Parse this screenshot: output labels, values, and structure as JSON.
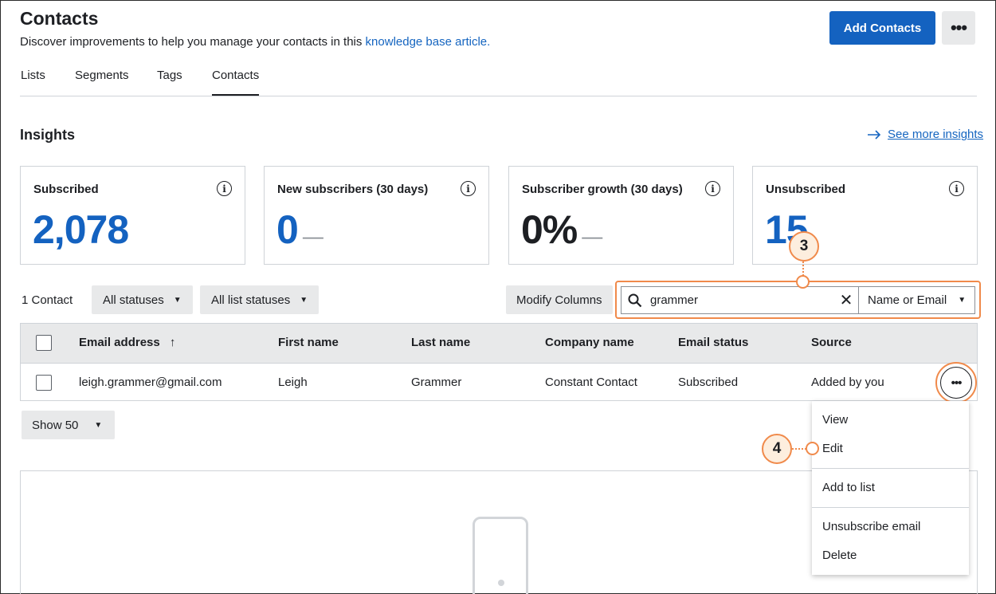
{
  "page": {
    "title": "Contacts",
    "subtitle": "Discover improvements to help you manage your contacts in this ",
    "subtitle_link": "knowledge base article."
  },
  "header": {
    "add_contacts": "Add Contacts",
    "more_icon": "more-horizontal-icon"
  },
  "tabs": [
    {
      "label": "Lists"
    },
    {
      "label": "Segments"
    },
    {
      "label": "Tags"
    },
    {
      "label": "Contacts",
      "active": true
    }
  ],
  "insights": {
    "title": "Insights",
    "see_more": "See more insights",
    "cards": [
      {
        "label": "Subscribed",
        "value": "2,078",
        "dash": ""
      },
      {
        "label": "New subscribers (30 days)",
        "value": "0",
        "dash": "—"
      },
      {
        "label": "Subscriber growth (30 days)",
        "value": "0%",
        "dash": "—"
      },
      {
        "label": "Unsubscribed",
        "value": "15",
        "dash": ""
      }
    ]
  },
  "filters": {
    "count": "1 Contact",
    "statuses": "All statuses",
    "list_statuses": "All list statuses",
    "modify_columns": "Modify Columns",
    "search_value": "grammer",
    "search_field": "Name or Email"
  },
  "table": {
    "headers": [
      "Email address",
      "First name",
      "Last name",
      "Company name",
      "Email status",
      "Source"
    ],
    "rows": [
      [
        "leigh.grammer@gmail.com",
        "Leigh",
        "Grammer",
        "Constant Contact",
        "Subscribed",
        "Added by you"
      ]
    ]
  },
  "pagination": {
    "show": "Show 50"
  },
  "row_menu": {
    "items": [
      "View",
      "Edit",
      "Add to list",
      "Unsubscribe email",
      "Delete"
    ]
  },
  "callouts": {
    "search": "3",
    "edit": "4"
  },
  "colors": {
    "primary": "#1462c0",
    "link": "#1565c0",
    "callout": "#f08a4b"
  }
}
